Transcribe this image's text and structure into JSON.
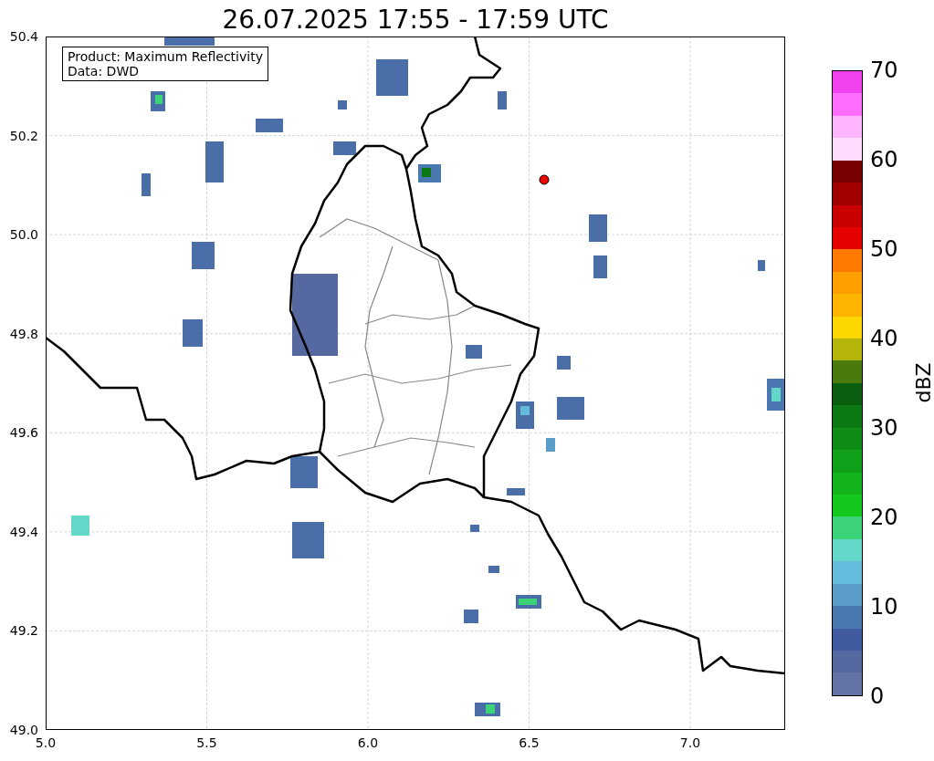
{
  "title": "26.07.2025 17:55 - 17:59 UTC",
  "legend": [
    "Product: Maximum Reflectivity",
    "Data: DWD"
  ],
  "x_ticks": [
    "5.0",
    "5.5",
    "6.0",
    "6.5",
    "7.0"
  ],
  "y_ticks": [
    "50.4",
    "50.2",
    "50.0",
    "49.8",
    "49.6",
    "49.4",
    "49.2",
    "49.0"
  ],
  "colorbar": {
    "label": "dBZ",
    "ticks": [
      "70",
      "60",
      "50",
      "40",
      "30",
      "20",
      "10",
      "0"
    ],
    "bands": [
      {
        "color": "#f040f0"
      },
      {
        "color": "#ff6eff"
      },
      {
        "color": "#ffb4ff"
      },
      {
        "color": "#ffdcff"
      },
      {
        "color": "#780000"
      },
      {
        "color": "#a00000"
      },
      {
        "color": "#c80000"
      },
      {
        "color": "#e60000"
      },
      {
        "color": "#ff7800"
      },
      {
        "color": "#ffa000"
      },
      {
        "color": "#ffb400"
      },
      {
        "color": "#ffd700"
      },
      {
        "color": "#b4b40a"
      },
      {
        "color": "#4a7a0c"
      },
      {
        "color": "#0a5e10"
      },
      {
        "color": "#0c7814"
      },
      {
        "color": "#0e8c16"
      },
      {
        "color": "#10a01a"
      },
      {
        "color": "#12b41c"
      },
      {
        "color": "#14c81e"
      },
      {
        "color": "#3cd278"
      },
      {
        "color": "#64d8c8"
      },
      {
        "color": "#64bcdc"
      },
      {
        "color": "#5a9cc8"
      },
      {
        "color": "#4a78b0"
      },
      {
        "color": "#405aa0"
      },
      {
        "color": "#5668a0"
      },
      {
        "color": "#6473a5"
      }
    ]
  }
}
